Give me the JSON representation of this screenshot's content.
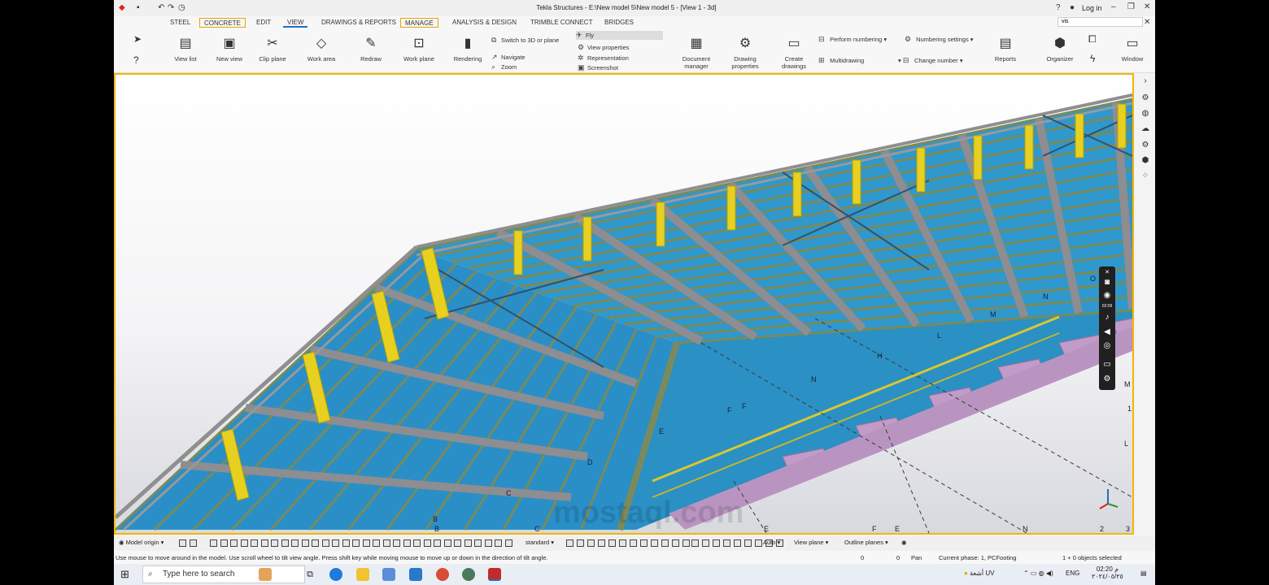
{
  "window": {
    "title": "Tekla Structures - E:\\New model 5\\New model 5  - [View 1 - 3d]",
    "login": "Log in"
  },
  "menu_tabs": [
    "STEEL",
    "CONCRETE",
    "EDIT",
    "VIEW",
    "DRAWINGS & REPORTS",
    "MANAGE",
    "ANALYSIS & DESIGN",
    "TRIMBLE CONNECT",
    "BRIDGES"
  ],
  "search": {
    "value": "vis"
  },
  "ribbon": {
    "view_list": "View list",
    "new_view": "New view",
    "clip_plane": "Clip plane",
    "work_area": "Work area",
    "redraw": "Redraw",
    "work_plane": "Work plane",
    "rendering": "Rendering",
    "switch_3d": "Switch to 3D or plane",
    "navigate": "Navigate",
    "zoom": "Zoom",
    "fly": "Fly",
    "view_properties": "View properties",
    "representation": "Representation",
    "screenshot": "Screenshot",
    "document_manager": [
      "Document",
      "manager"
    ],
    "drawing_properties": [
      "Drawing",
      "properties"
    ],
    "create_drawings": [
      "Create",
      "drawings"
    ],
    "perform_numbering": "Perform numbering",
    "multidrawing": "Multidrawing",
    "numbering_settings": "Numbering settings",
    "change_number": "Change number",
    "reports": "Reports",
    "organizer": "Organizer",
    "window": "Window"
  },
  "model_labels": {
    "grid_letters": [
      "D",
      "C",
      "B",
      "B",
      "C",
      "E",
      "F",
      "F",
      "N",
      "H",
      "L",
      "M",
      "N",
      "O",
      "E",
      "F",
      "E",
      "N",
      "M",
      "L",
      "2",
      "3",
      "1"
    ]
  },
  "recorder": {
    "time": "02:09"
  },
  "bottom_toolbar": {
    "model_origin": "Model origin",
    "standard": "standard",
    "auto": "Auto",
    "view_plane": "View plane",
    "outline_planes": "Outline planes"
  },
  "status": {
    "hint": "Use mouse to move around in the model. Use scroll wheel to tilt view angle. Press shift key while moving mouse to move up or down in the direction of tilt angle.",
    "coord_1": "0",
    "coord_2": "0",
    "mode": "Pan",
    "phase": "Current phase: 1, PCFooting",
    "selected": "1 + 0 objects selected"
  },
  "taskbar": {
    "search_placeholder": "Type here to search",
    "weather": "أشعة UV",
    "lang": "ENG",
    "time": "02:20 م",
    "date": "٢٠٢٤/٠٥/٢٥"
  },
  "watermark": "mostaql.com",
  "colors": {
    "accent_border": "#f2b600",
    "ribbon_blue": "#1e6fbf",
    "roof_blue": "#2a8fc6",
    "column_yellow": "#e8d020",
    "footing_pink": "#c39bc8"
  }
}
